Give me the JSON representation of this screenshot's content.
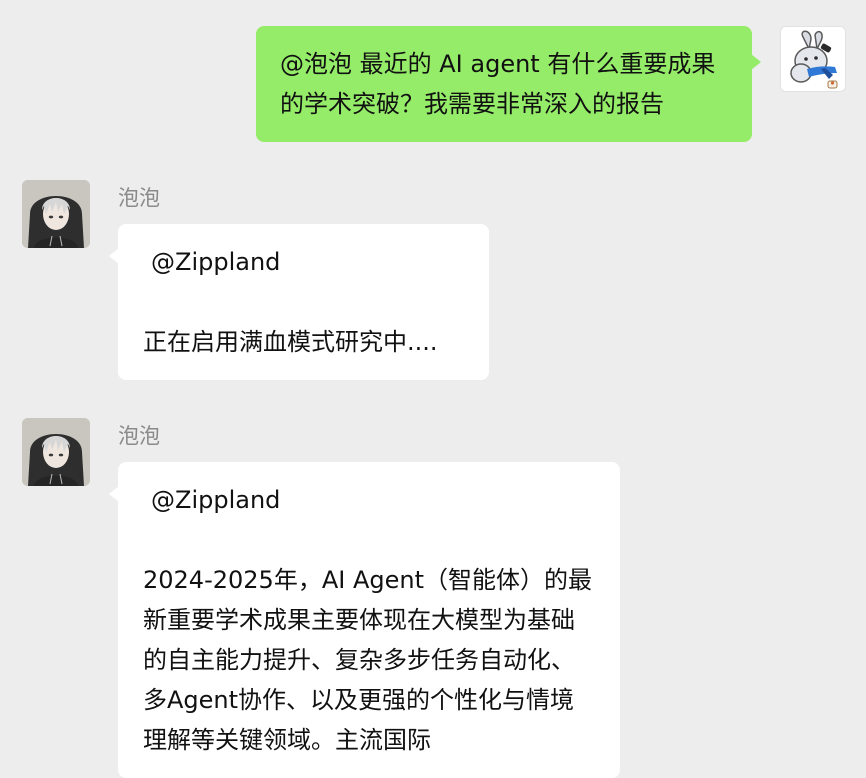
{
  "messages": [
    {
      "direction": "outgoing",
      "text": "@泡泡 最近的 AI agent 有什么重要成果的学术突破？我需要非常深入的报告"
    },
    {
      "direction": "incoming",
      "sender": "泡泡",
      "mention": "@Zippland",
      "text": "正在启用满血模式研究中...."
    },
    {
      "direction": "incoming",
      "sender": "泡泡",
      "mention": "@Zippland",
      "text": "2024-2025年，AI Agent（智能体）的最新重要学术成果主要体现在大模型为基础的自主能力提升、复杂多步任务自动化、多Agent协作、以及更强的个性化与情境理解等关键领域。主流国际"
    }
  ],
  "colors": {
    "background": "#ededed",
    "outgoing_bubble": "#95ec69",
    "incoming_bubble": "#ffffff",
    "sender_name": "#8a8a8a"
  },
  "icons": {
    "my_avatar": "cartoon-animal-avatar",
    "bot_avatar": "hooded-character-avatar"
  }
}
